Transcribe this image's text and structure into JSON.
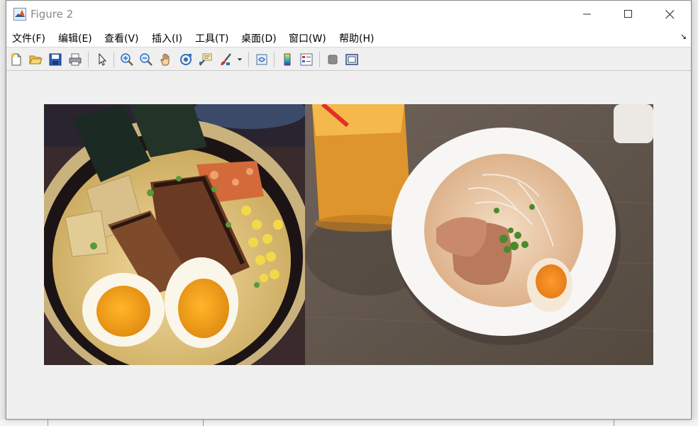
{
  "window": {
    "title": "Figure 2"
  },
  "menu": [
    {
      "id": "file",
      "label": "文件(F)"
    },
    {
      "id": "edit",
      "label": "编辑(E)"
    },
    {
      "id": "view",
      "label": "查看(V)"
    },
    {
      "id": "insert",
      "label": "插入(I)"
    },
    {
      "id": "tools",
      "label": "工具(T)"
    },
    {
      "id": "desktop",
      "label": "桌面(D)"
    },
    {
      "id": "window",
      "label": "窗口(W)"
    },
    {
      "id": "help",
      "label": "帮助(H)"
    }
  ],
  "toolbar": [
    "new-figure-icon",
    "open-file-icon",
    "save-icon",
    "print-icon",
    "edit-plot-pointer-icon",
    "zoom-in-icon",
    "zoom-out-icon",
    "pan-hand-icon",
    "rotate-3d-icon",
    "data-cursor-icon",
    "brush-icon",
    "link-plot-icon",
    "colorbar-icon",
    "legend-icon",
    "hide-plot-tools-icon",
    "show-plot-tools-icon"
  ],
  "image": {
    "left_photo": "bowl of ramen with chashu pork, soft-boiled eggs, corn, nori and scallions",
    "right_photo": "white bowl of tonkotsu ramen with chashu, egg and scallions next to orange drink"
  },
  "colors": {
    "titlebar": "#ffffff",
    "window_bg": "#f0f0f0",
    "title_text": "#8a8a8a"
  }
}
